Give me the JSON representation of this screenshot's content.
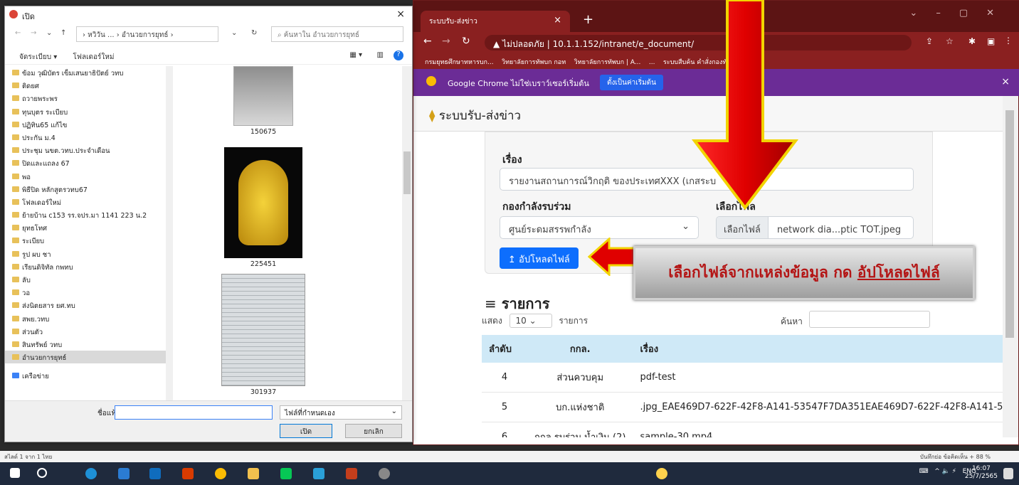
{
  "chrome": {
    "tab_title": "ระบบรับ-ส่งข่าว",
    "tab_close": "×",
    "new_tab": "+",
    "address_security": "ไม่ปลอดภัย",
    "address_url": "10.1.1.152/intranet/e_document/",
    "bookmarks": [
      "กรมยุทธศึกษาทหารบก...",
      "วิทยาลัยการทัพบก กอท",
      "วิทยาลัยการทัพบก | A...",
      "...",
      "ระบบสืบค้น คำสั่งกองทั..."
    ],
    "infobar_text": "Google Chrome ไม่ใช่เบราว์เซอร์เริ่มต้น",
    "infobar_button": "ตั้งเป็นค่าเริ่มต้น",
    "infobar_close": "×"
  },
  "app": {
    "title": "ระบบรับ-ส่งข่าว",
    "subject_label": "เรื่อง",
    "subject_value": "รายงานสถานการณ์วิกฤติ ของประเทศXXX (เกสระบ",
    "unit_label": "กองกำลังรบร่วม",
    "unit_value": "ศูนย์ระดมสรรพกำลัง",
    "file_label": "เลือกไฟล",
    "file_button": "เลือกไฟล์",
    "file_name": "network dia...ptic TOT.jpeg",
    "upload_label": "อัปโหลดไฟล์",
    "upload_icon": "↥",
    "list_title": "รายการ",
    "list_icon": "≡",
    "show_prefix": "แสดง",
    "show_value": "10",
    "show_suffix": "รายการ",
    "search_label": "ค้นหา",
    "columns": [
      "ลำดับ",
      "กกล.",
      "เรื่อง"
    ],
    "rows": [
      [
        "4",
        "ส่วนควบคุม",
        "pdf-test"
      ],
      [
        "5",
        "บก.แห่งชาติ",
        ".jpg_EAE469D7-622F-42F8-A141-53547F7DA351EAE469D7-622F-42F8-A141-5"
      ],
      [
        "6",
        "กกล.รบร่วม น้ำเงิน (2)",
        "sample-30.mp4"
      ]
    ]
  },
  "dialog": {
    "title": "เปิด",
    "close": "×",
    "path": "› หวิวัน ... › อำนวยการยุทธ์ ›",
    "search_placeholder": "ค้นหาใน อำนวยการยุทธ์",
    "organize": "จัดระเบียบ ▾",
    "new_folder": "โฟลเดอร์ใหม่",
    "folders": [
      "ข้อม วุฒิบัตร เข็มเสนยาธิปัตย์ วทบ",
      "ติดยศ",
      "ถวายพระพร",
      "ทุนบุตร ระเบียบ",
      "ปฏิทิน65 แก้ไข",
      "ประกัน ม.4",
      "ประชุม นขต.วทบ.ประจำเดือน",
      "ปิดและแถลง 67",
      "พอ",
      "พิธีปิด หลักสูตรวทบ67",
      "โฟลเดอร์ใหม่",
      "ย้ายบ้าน c153 รร.จปร.มา 1141 223 น.2",
      "ยุทธโทศ",
      "ระเบียบ",
      "รูป ผบ ชา",
      "เรียนดิจิทัล กพทบ",
      "ลับ",
      "วอ",
      "ส่งนิตยสาร ยศ.ทบ",
      "สพย.วทบ",
      "ส่วนตัว",
      "สินทรัพย์ วทบ",
      "อำนวยการยุทธ์"
    ],
    "network": "เครือข่าย",
    "thumbs": [
      "150675",
      "225451",
      "301937"
    ],
    "filename_label": "ชื่อแฟ้ม:",
    "filename_value": "",
    "filetype": "ไฟล์ที่กำหนดเอง",
    "open": "เปิด",
    "cancel": "ยกเลิก"
  },
  "statusbar": {
    "left": "สไลด์ 1 จาก 1    ไทย",
    "right": "บันทึกย่อ   ข้อคิดเห็น                          + 88 %"
  },
  "taskbar": {
    "tray": "ENG",
    "time": "16:07",
    "date": "25/7/2565"
  },
  "annotation": {
    "text": "เลือกไฟล์จากแหล่งข้อมูล กด ",
    "emph": "อัปโหลดไฟล์"
  },
  "colors": {
    "chrome_frame": "#8a2020",
    "infobar": "#6b2c96",
    "primary": "#0d6efd",
    "table_header": "#cfe9f7",
    "arrow_red": "#e00000"
  }
}
